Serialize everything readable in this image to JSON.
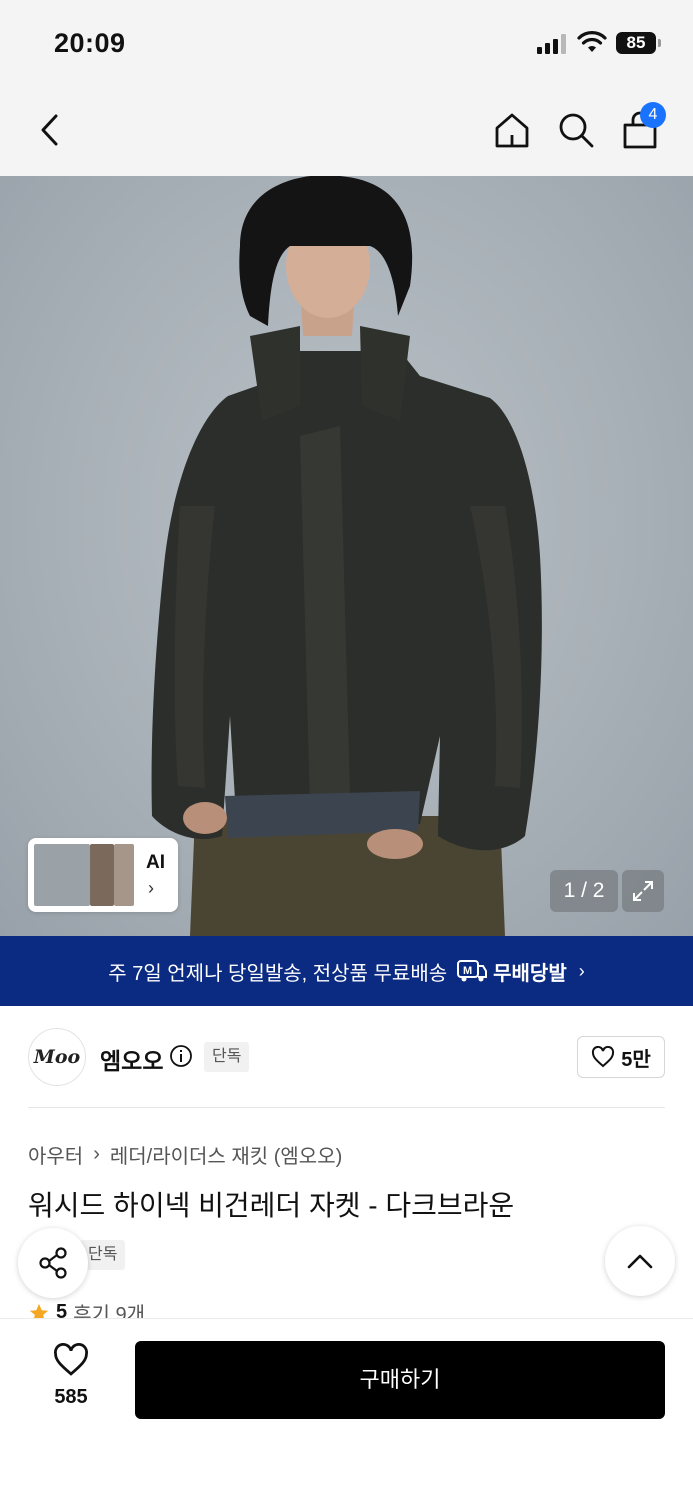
{
  "status": {
    "time": "20:09",
    "battery": "85"
  },
  "nav": {
    "cart_count": "4"
  },
  "gallery": {
    "ai_label": "AI",
    "pager": "1 / 2"
  },
  "banner": {
    "text": "주 7일 언제나 당일발송, 전상품 무료배송",
    "brand": "무배당발",
    "brand_icon_letter": "M"
  },
  "brand": {
    "logo_text": "Moo",
    "name": "엠오오",
    "tag": "단독",
    "likes": "5만"
  },
  "product": {
    "breadcrumb": [
      "아우터",
      "레더/라이더스 재킷 (엠오오)"
    ],
    "title": "워시드 하이넥 비건레더 자켓 - 다크브라운",
    "tag": "단독",
    "rating": "5",
    "reviews": "후기 9개"
  },
  "bottom": {
    "wish_count": "585",
    "buy_label": "구매하기"
  },
  "colors": {
    "banner_bg": "#0b2a82",
    "badge": "#1a73ff",
    "buy_bg": "#000000",
    "star": "#f5a623"
  }
}
